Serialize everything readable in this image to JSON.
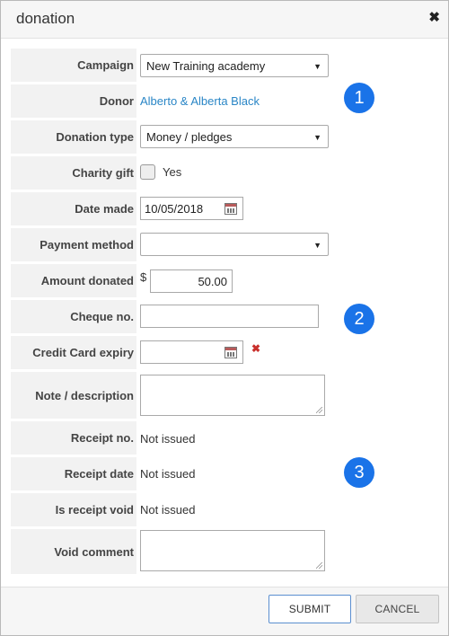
{
  "dialog": {
    "title": "donation",
    "close_glyph": "✖"
  },
  "form": {
    "campaign": {
      "label": "Campaign",
      "value": "New Training academy"
    },
    "donor": {
      "label": "Donor",
      "value": "Alberto & Alberta Black"
    },
    "donation_type": {
      "label": "Donation type",
      "value": "Money / pledges"
    },
    "charity_gift": {
      "label": "Charity gift",
      "option": "Yes",
      "checked": false
    },
    "date_made": {
      "label": "Date made",
      "value": "10/05/2018"
    },
    "payment_method": {
      "label": "Payment method",
      "value": ""
    },
    "amount_donated": {
      "label": "Amount donated",
      "currency": "$",
      "value": "50.00"
    },
    "cheque_no": {
      "label": "Cheque no.",
      "value": ""
    },
    "credit_card_expiry": {
      "label": "Credit Card expiry",
      "value": "",
      "required_mark": "✖"
    },
    "note": {
      "label": "Note / description",
      "value": ""
    },
    "receipt_no": {
      "label": "Receipt no.",
      "value": "Not issued"
    },
    "receipt_date": {
      "label": "Receipt date",
      "value": "Not issued"
    },
    "receipt_void": {
      "label": "Is receipt void",
      "value": "Not issued"
    },
    "void_comment": {
      "label": "Void comment",
      "value": ""
    }
  },
  "badges": [
    "1",
    "2",
    "3"
  ],
  "colors": {
    "badge": "#1a73e8",
    "link": "#2a86c6",
    "required": "#c9302c"
  },
  "footer": {
    "submit_label": "SUBMIT",
    "cancel_label": "CANCEL"
  }
}
